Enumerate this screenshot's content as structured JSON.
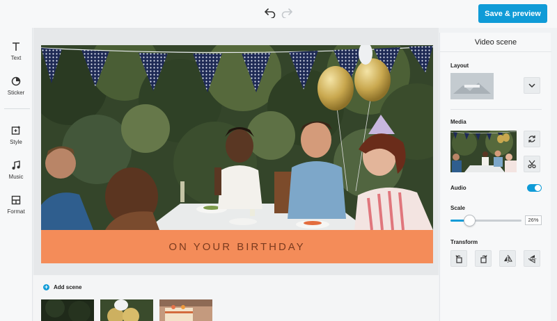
{
  "toolbar": {
    "undo_icon": "undo-arrow-icon",
    "redo_icon": "redo-arrow-icon",
    "save_label": "Save & preview",
    "accent_color": "#0f9bd7"
  },
  "sidebar": {
    "items": [
      {
        "label": "Text",
        "icon": "text-icon"
      },
      {
        "label": "Sticker",
        "icon": "sticker-icon"
      },
      {
        "label": "Style",
        "icon": "style-icon"
      },
      {
        "label": "Music",
        "icon": "music-note-icon"
      },
      {
        "label": "Format",
        "icon": "format-layout-icon"
      }
    ]
  },
  "canvas": {
    "caption": "ON YOUR BIRTHDAY",
    "caption_bg": "#f48c59",
    "caption_color": "#7a3a1e"
  },
  "scenes": {
    "add_label": "Add scene",
    "thumbnails": [
      "scene-1",
      "scene-2",
      "scene-3"
    ]
  },
  "panel": {
    "title": "Video scene",
    "layout_label": "Layout",
    "media_label": "Media",
    "audio_label": "Audio",
    "audio_on": true,
    "scale_label": "Scale",
    "scale_value": "26%",
    "scale_fraction": 0.26,
    "transform_label": "Transform",
    "transform_icons": [
      "rotate-left-icon",
      "rotate-right-icon",
      "flip-horizontal-icon",
      "flip-vertical-icon"
    ]
  }
}
